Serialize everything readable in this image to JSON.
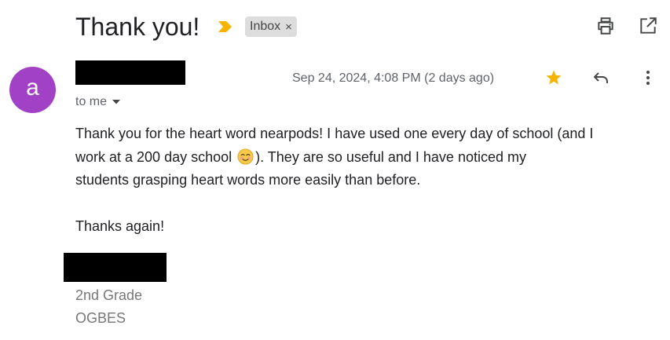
{
  "email": {
    "subject": "Thank you!",
    "label": "Inbox",
    "label_remove": "×",
    "sender_initial": "a",
    "date": "Sep 24, 2024, 4:08 PM (2 days ago)",
    "recipient": "to me",
    "body": {
      "line1": "Thank you for the heart word nearpods! I have used one every day of school (and I",
      "line2a": "work at a 200 day school ",
      "line2b": "). They are so useful and I have noticed my",
      "line3": "students grasping heart words more easily than before.",
      "closing": "Thanks again!"
    },
    "signature": {
      "line1": "2nd Grade",
      "line2": "OGBES"
    }
  },
  "icons": {
    "importance": "importance-marker-icon",
    "print": "print-icon",
    "popout": "open-in-new-window-icon",
    "star": "star-icon",
    "reply": "reply-icon",
    "more": "more-vert-icon",
    "recipient_dropdown": "chevron-down-icon",
    "emoji": "smiling-face-emoji-icon"
  },
  "colors": {
    "avatar": "#a142c6",
    "star": "#f4b400",
    "importance": "#f4b400",
    "label_chip": "#dddddd"
  }
}
